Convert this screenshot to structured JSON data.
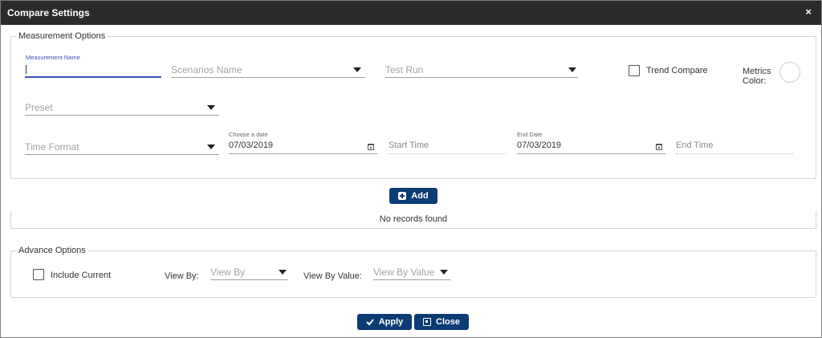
{
  "dialog": {
    "title": "Compare Settings",
    "close_glyph": "×"
  },
  "measurement": {
    "legend": "Measurement Options",
    "name_label": "Measurement Name",
    "name_value": "",
    "scenarios_placeholder": "Scenarios Name",
    "test_run_placeholder": "Test Run",
    "trend_compare_label": "Trend Compare",
    "trend_compare_checked": false,
    "metrics_color_label_line1": "Metrics",
    "metrics_color_label_line2": "Color:",
    "preset_placeholder": "Preset",
    "time_format_placeholder": "Time Format",
    "start_date_label": "Choose a date",
    "start_date_value": "07/03/2019",
    "start_time_placeholder": "Start Time",
    "end_date_label": "End Date",
    "end_date_value": "07/03/2019",
    "end_time_placeholder": "End Time"
  },
  "add_button_label": "Add",
  "records_message": "No records found",
  "advance": {
    "legend": "Advance Options",
    "include_current_label": "Include Current",
    "include_current_checked": false,
    "view_by_label": "View By:",
    "view_by_placeholder": "View By",
    "view_by_value_label": "View By Value:",
    "view_by_value_placeholder": "View By Value"
  },
  "footer": {
    "apply_label": "Apply",
    "close_label": "Close"
  },
  "colors": {
    "titlebar": "#2b2b2b",
    "button": "#0b3c73",
    "accent": "#3f51b5"
  },
  "icons": {
    "close": "close-icon",
    "dropdown": "chevron-down-icon",
    "calendar": "calendar-icon",
    "add": "plus-icon",
    "apply": "check-icon",
    "close_button": "window-close-icon"
  }
}
